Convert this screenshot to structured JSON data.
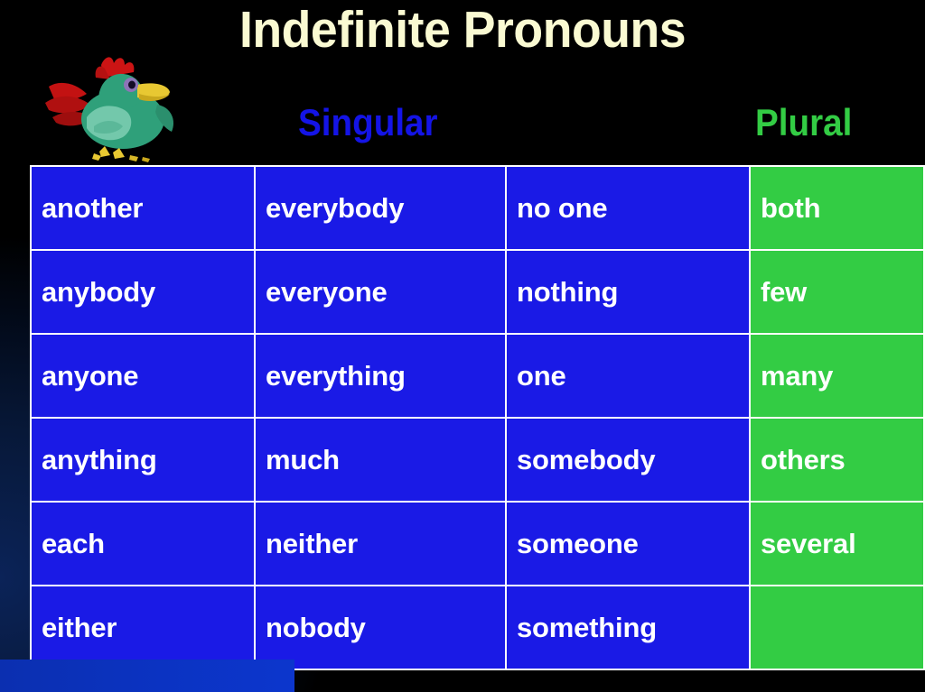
{
  "slide": {
    "title": "Indefinite Pronouns",
    "background_color": "#000000",
    "background_glow_color": "#0b2358",
    "title_color": "#fafad2",
    "bottom_bar_color": "#0b33c2"
  },
  "headers": {
    "singular": {
      "label": "Singular",
      "color": "#1414e6"
    },
    "plural": {
      "label": "Plural",
      "color": "#33cc44"
    }
  },
  "clipart": {
    "name": "cartoon-bird-rooster",
    "colors": {
      "body": "#2fa07a",
      "body_light": "#6fc7a8",
      "comb": "#c81414",
      "beak": "#e8c832",
      "feet": "#e8c832",
      "eye": "#7a5fa8"
    }
  },
  "table": {
    "singular_cell_color": "#1a1ae6",
    "plural_cell_color": "#33cc44",
    "text_color": "#ffffff",
    "grid_color": "#ffffff",
    "column_types": [
      "singular",
      "singular",
      "singular",
      "plural"
    ],
    "rows": [
      [
        "another",
        "everybody",
        "no one",
        "both"
      ],
      [
        "anybody",
        "everyone",
        "nothing",
        "few"
      ],
      [
        "anyone",
        "everything",
        "one",
        "many"
      ],
      [
        "anything",
        "much",
        "somebody",
        "others"
      ],
      [
        "each",
        "neither",
        "someone",
        "several"
      ],
      [
        "either",
        "nobody",
        "something",
        ""
      ]
    ]
  }
}
